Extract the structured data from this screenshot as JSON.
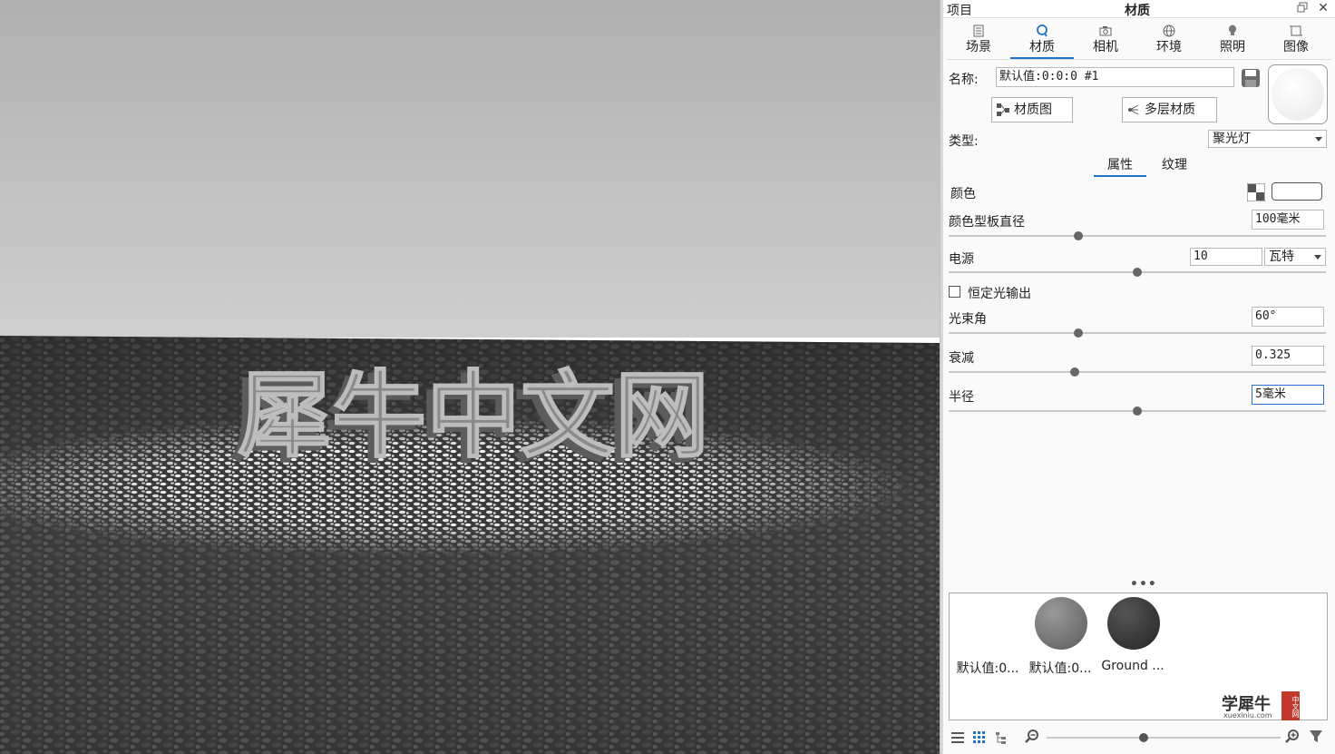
{
  "viewport": {
    "scene_text": "犀牛中文网"
  },
  "panel": {
    "title_left": "项目",
    "title_center": "材质",
    "tabs": [
      {
        "label": "场景",
        "icon": "document-icon"
      },
      {
        "label": "材质",
        "icon": "material-sphere-icon"
      },
      {
        "label": "相机",
        "icon": "camera-icon"
      },
      {
        "label": "环境",
        "icon": "globe-icon"
      },
      {
        "label": "照明",
        "icon": "bulb-icon"
      },
      {
        "label": "图像",
        "icon": "frame-icon"
      }
    ],
    "active_tab": "材质",
    "name_label": "名称:",
    "name_value": "默认值:0:0:0 #1",
    "material_graph_label": "材质图",
    "multilayer_label": "多层材质",
    "type_label": "类型:",
    "type_value": "聚光灯",
    "subtabs": [
      "属性",
      "纹理"
    ],
    "active_subtab": "属性",
    "properties": {
      "color_label": "颜色",
      "color_value": "#ffffff",
      "template_diameter_label": "颜色型板直径",
      "template_diameter_value": "100毫米",
      "template_diameter_slider": 0.34,
      "power_label": "电源",
      "power_value": "10",
      "power_unit": "瓦特",
      "power_slider": 0.5,
      "constant_output_label": "恒定光输出",
      "constant_output_checked": false,
      "beam_angle_label": "光束角",
      "beam_angle_value": "60°",
      "beam_angle_slider": 0.34,
      "falloff_label": "衰减",
      "falloff_value": "0.325",
      "falloff_slider": 0.33,
      "radius_label": "半径",
      "radius_value": "5毫米",
      "radius_slider": 0.5
    },
    "library": {
      "items": [
        {
          "caption": "默认值:0...",
          "sphere": "none"
        },
        {
          "caption": "默认值:0...",
          "sphere": "#7a7a7a"
        },
        {
          "caption": "Ground ...",
          "sphere": "#3a3a3a"
        }
      ]
    },
    "watermark": {
      "line1": "学犀牛",
      "line2": "xuexiniu.com",
      "badge": "中文网"
    },
    "zoom_slider": 0.41
  }
}
